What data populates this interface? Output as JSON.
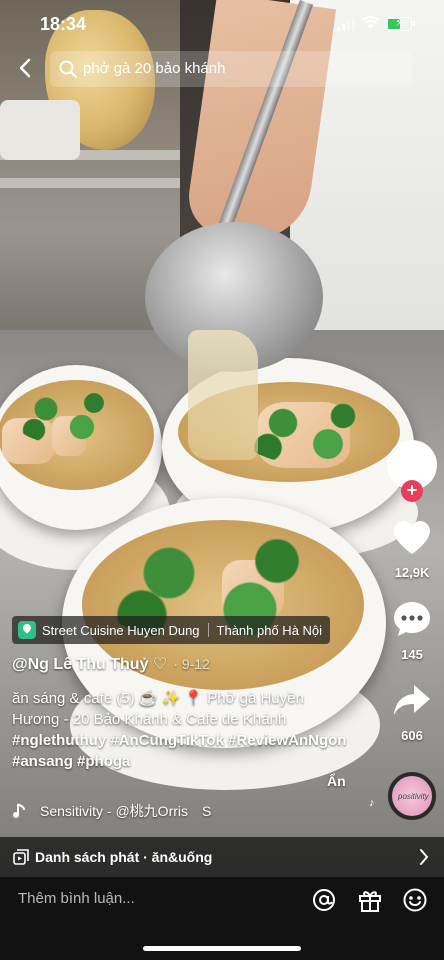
{
  "status_bar": {
    "time": "18:34"
  },
  "search": {
    "query": "phở gà 20 bảo khánh"
  },
  "actions": {
    "likes": "12,9K",
    "comments": "145",
    "shares": "606"
  },
  "location": {
    "place": "Street Cuisine Huyen Dung",
    "city": "Thành phố Hà Nội"
  },
  "post": {
    "username": "@Ng Lê Thu Thuỷ ♡",
    "date": "· 9-12",
    "caption_line1": "ăn sáng & cafe (5) ☕️ ✨ 📍 Phở gà Huyền",
    "caption_line2": "Hương - 20 Bảo Khánh & Cafe de Khánh",
    "hashtags_line1": "#nglethuthuy #AnCungTikTok #ReviewAnNgon",
    "hashtags_line2": "#ansang #phoga",
    "more_label": "Ẩn"
  },
  "music": {
    "title": "Sensitivity - @桃九Orris",
    "trail": "S",
    "disc_text": "positivity"
  },
  "playlist": {
    "label": "Danh sách phát · ăn&uống"
  },
  "comment_bar": {
    "placeholder": "Thêm bình luận..."
  },
  "icons": [
    "back-arrow-icon",
    "search-icon",
    "plus-icon",
    "heart-icon",
    "comment-icon",
    "share-icon",
    "music-note-icon",
    "playlist-icon",
    "chevron-right-icon",
    "at-icon",
    "gift-icon",
    "emoji-icon"
  ]
}
